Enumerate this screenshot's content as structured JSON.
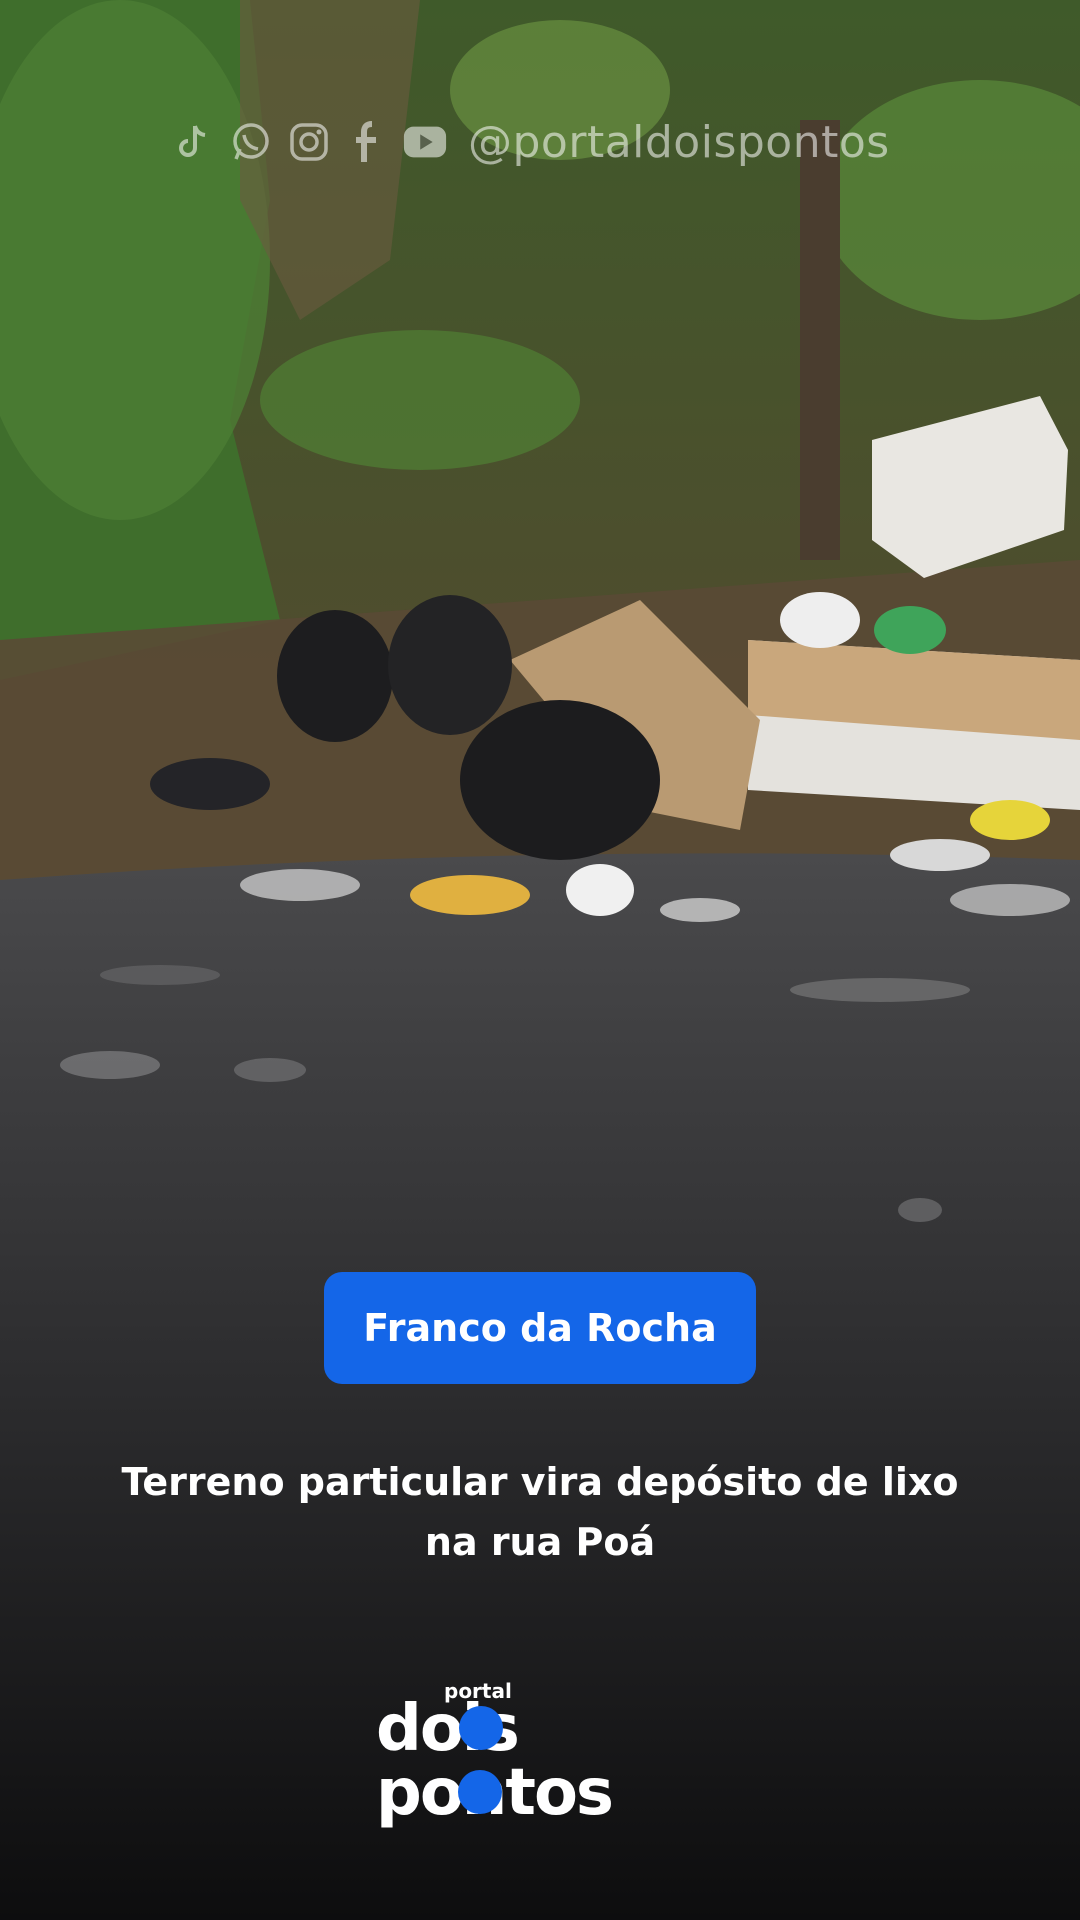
{
  "overlay": {
    "social_handle": "@portaldoispontos",
    "social_icons": [
      "tiktok-icon",
      "whatsapp-icon",
      "instagram-icon",
      "facebook-icon",
      "youtube-icon"
    ],
    "location_badge": "Franco da Rocha",
    "headline_line1": "Terreno particular vira depósito de lixo",
    "headline_line2": "na rua Poá"
  },
  "logo": {
    "small_text": "portal",
    "line1": "dois",
    "line2": "pontos",
    "accent_color": "#1466e8"
  },
  "colors": {
    "badge_bg": "#1466e8",
    "text": "#ffffff"
  }
}
